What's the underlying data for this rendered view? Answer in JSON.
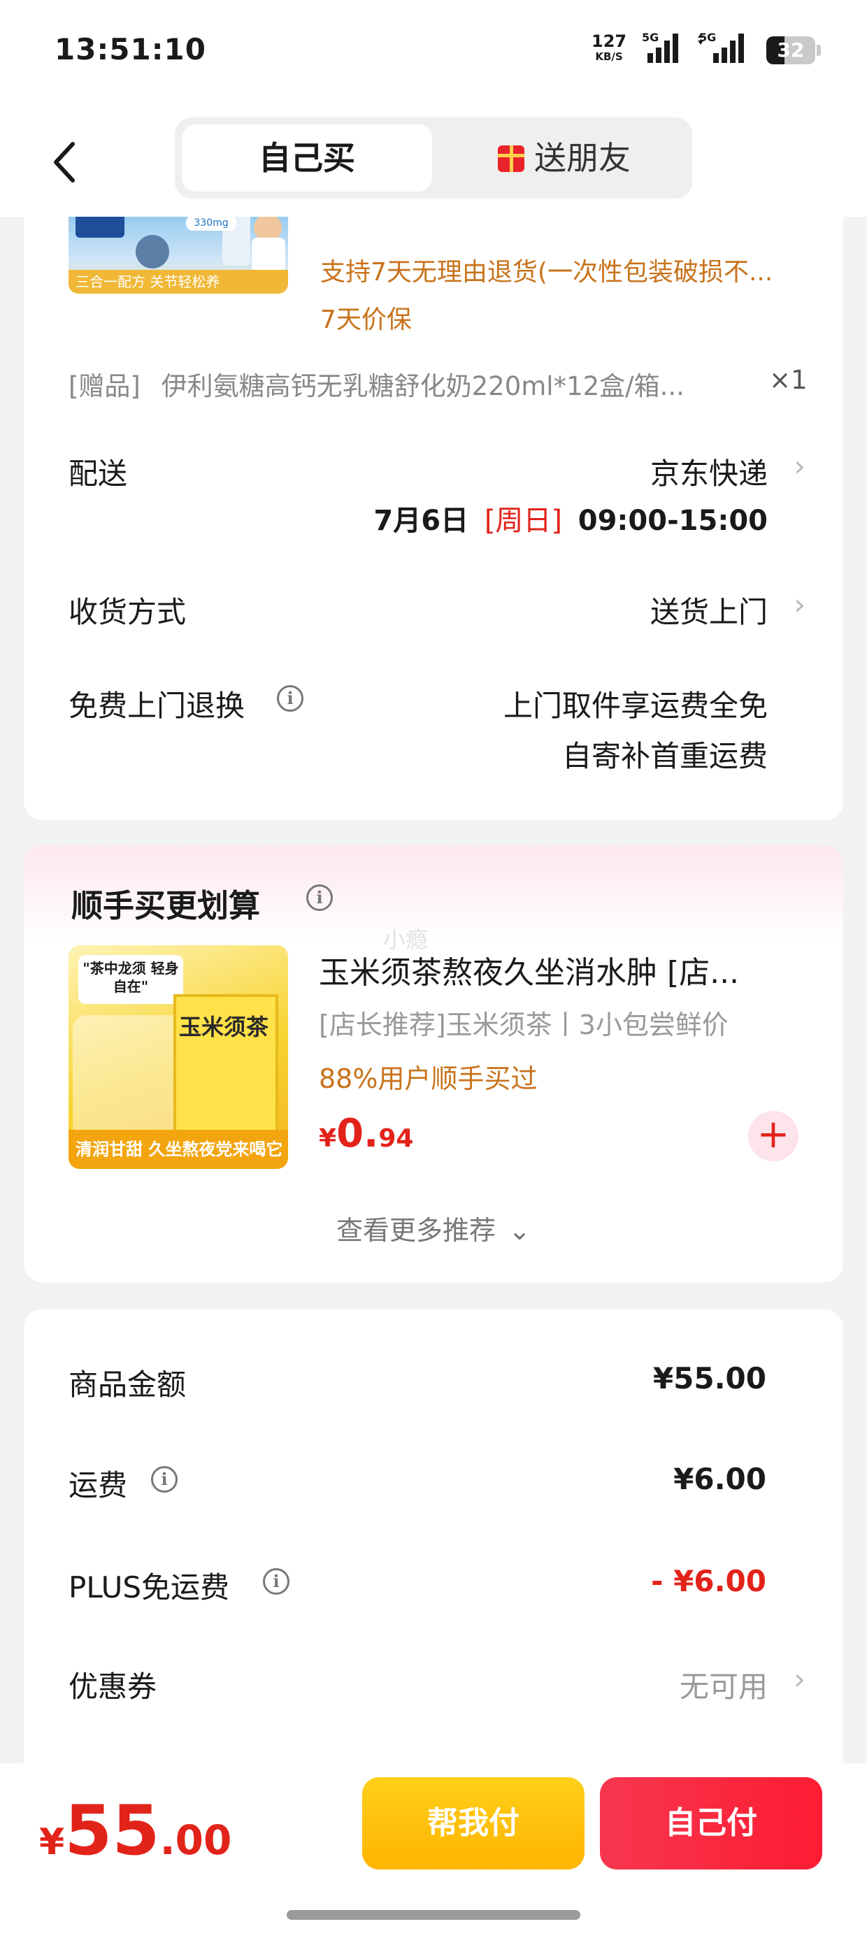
{
  "status_bar": {
    "time": "13:51:10",
    "net_speed": "127",
    "net_unit": "KB/S",
    "sim1": "5G",
    "sim2": "5G",
    "battery": "32"
  },
  "header": {
    "tab_self": "自己买",
    "tab_gift": "送朋友"
  },
  "product": {
    "thumb_banner": "三合一配方 关节轻松养",
    "thumb_badge": "330mg",
    "service_return": "支持7天无理由退货(一次性包装破损不...",
    "service_price": "7天价保",
    "gift_label": "[赠品]",
    "gift_name": "伊利氨糖高钙无乳糖舒化奶220ml*12盒/箱...",
    "gift_qty": "×1"
  },
  "delivery": {
    "label": "配送",
    "carrier": "京东快递",
    "date": "7月6日",
    "weekday": "[周日]",
    "time_window": "09:00-15:00"
  },
  "receive": {
    "label": "收货方式",
    "value": "送货上门"
  },
  "free_return": {
    "label": "免费上门退换",
    "line1": "上门取件享运费全免",
    "line2": "自寄补首重运费"
  },
  "recommend": {
    "title": "顺手买更划算",
    "watermark": "小瘾",
    "thumb_tag": "\"茶中龙须 轻身自在\"",
    "thumb_bag": "玉米须茶",
    "thumb_bottom": "清润甘甜 久坐熬夜党来喝它",
    "name": "玉米须茶熬夜久坐消水肿 [店...",
    "desc": "[店长推荐]玉米须茶丨3小包尝鲜价",
    "bought": "88%用户顺手买过",
    "price_cur": "¥",
    "price_int": "0.",
    "price_dec": "94",
    "more": "查看更多推荐"
  },
  "amounts": {
    "goods_label": "商品金额",
    "goods_value": "¥55.00",
    "freight_label": "运费",
    "freight_value": "¥6.00",
    "plus_label": "PLUS免运费",
    "plus_value": "- ¥6.00",
    "coupon_label": "优惠券",
    "coupon_value": "无可用"
  },
  "bottom": {
    "total_cur": "¥",
    "total_int": "55",
    "total_dec": ".00",
    "help_pay": "帮我付",
    "self_pay": "自己付"
  },
  "colors": {
    "accent_red": "#e2231a",
    "service_orange": "#c8731c",
    "help_button": "#ffb400",
    "pay_button": "#fd1c32"
  }
}
